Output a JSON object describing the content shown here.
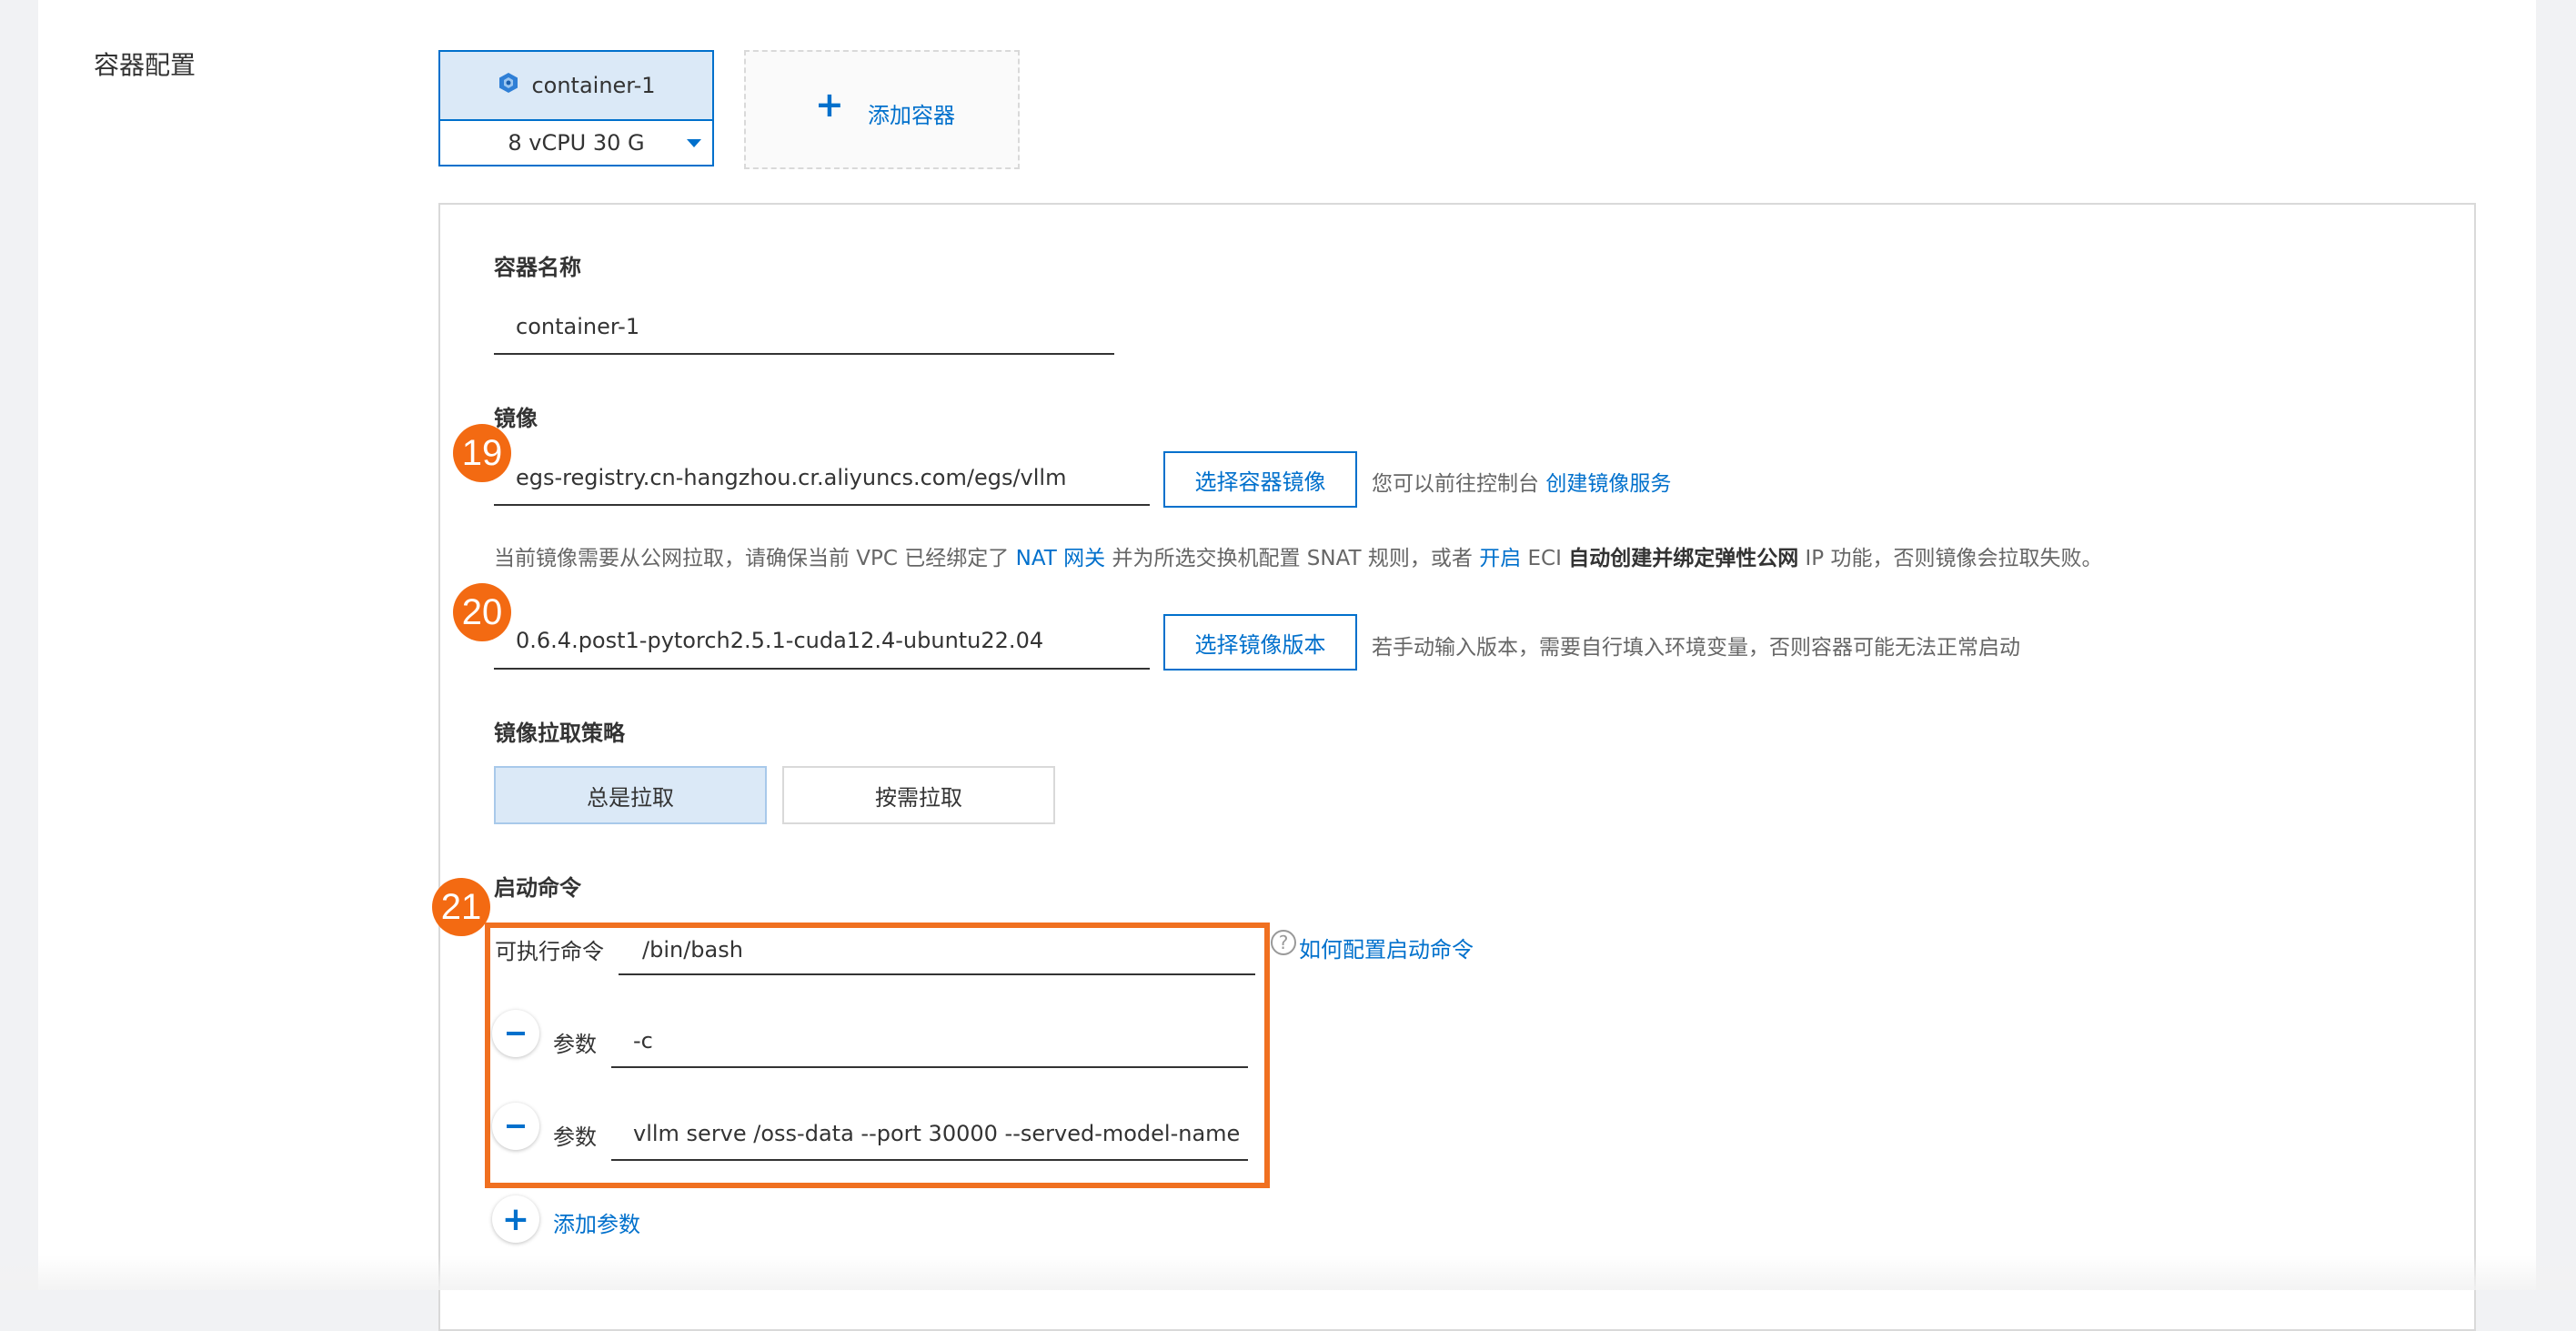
{
  "section_label": "容器配置",
  "container_tab": {
    "name": "container-1",
    "spec": "8 vCPU 30 G"
  },
  "add_container_label": "添加容器",
  "container_name": {
    "label": "容器名称",
    "value": "container-1"
  },
  "image": {
    "label": "镜像",
    "value": "egs-registry.cn-hangzhou.cr.aliyuncs.com/egs/vllm",
    "select_button": "选择容器镜像",
    "hint_prefix": "您可以前往控制台",
    "hint_link": "创建镜像服务",
    "notice": {
      "part1": "当前镜像需要从公网拉取，请确保当前 VPC 已经绑定了",
      "link1": "NAT 网关",
      "part2": "并为所选交换机配置 SNAT 规则，或者",
      "link2": "开启",
      "part3": "ECI",
      "bold": "自动创建并绑定弹性公网",
      "part4": "IP 功能，否则镜像会拉取失败。"
    },
    "version_value": "0.6.4.post1-pytorch2.5.1-cuda12.4-ubuntu22.04",
    "version_button": "选择镜像版本",
    "version_hint": "若手动输入版本，需要自行填入环境变量，否则容器可能无法正常启动"
  },
  "pull_policy": {
    "label": "镜像拉取策略",
    "options": [
      "总是拉取",
      "按需拉取"
    ],
    "selected": "总是拉取"
  },
  "startup": {
    "label": "启动命令",
    "exec_label": "可执行命令",
    "exec_value": "/bin/bash",
    "help_link": "如何配置启动命令",
    "param_label": "参数",
    "params": [
      "-c",
      "vllm serve /oss-data --port 30000 --served-model-name"
    ],
    "add_param": "添加参数"
  },
  "badges": [
    "19",
    "20",
    "21"
  ],
  "colors": {
    "accent": "#0070cc",
    "badge": "#f36a12",
    "highlight": "#f07020"
  }
}
